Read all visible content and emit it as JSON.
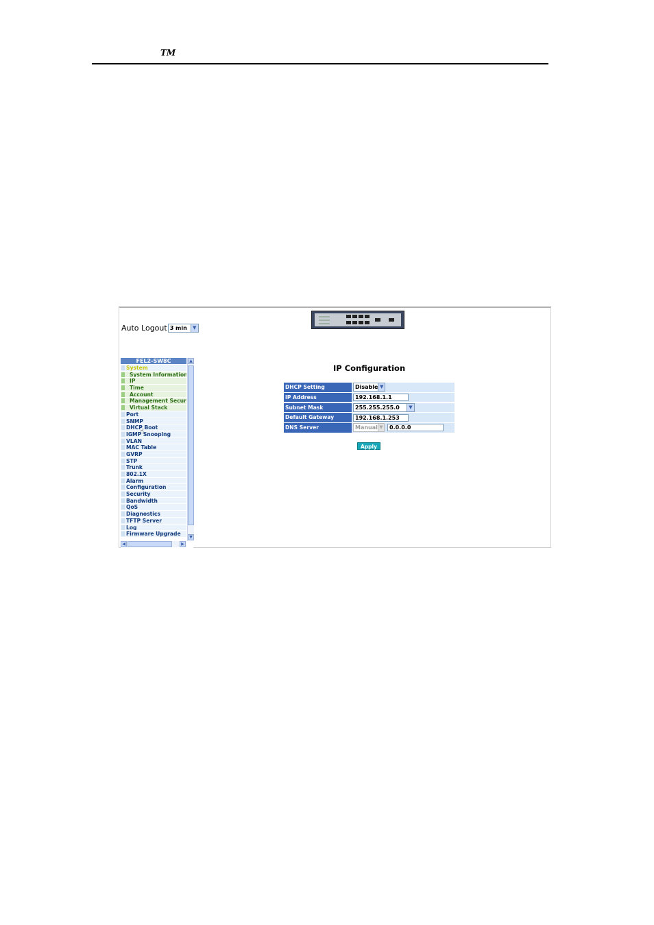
{
  "doc_header": {
    "mark": "TM"
  },
  "auto_logout": {
    "label": "Auto Logout",
    "value": "3 min"
  },
  "menu": {
    "title": "FEL2-SW8C",
    "items": [
      {
        "label": "System",
        "level": 0
      },
      {
        "label": "System Information",
        "level": 1
      },
      {
        "label": "IP",
        "level": 1
      },
      {
        "label": "Time",
        "level": 1
      },
      {
        "label": "Account",
        "level": 1
      },
      {
        "label": "Management Security",
        "level": 1
      },
      {
        "label": "Virtual Stack",
        "level": 1
      },
      {
        "label": "Port",
        "level": 0
      },
      {
        "label": "SNMP",
        "level": 0
      },
      {
        "label": "DHCP Boot",
        "level": 0
      },
      {
        "label": "IGMP Snooping",
        "level": 0
      },
      {
        "label": "VLAN",
        "level": 0
      },
      {
        "label": "MAC Table",
        "level": 0
      },
      {
        "label": "GVRP",
        "level": 0
      },
      {
        "label": "STP",
        "level": 0
      },
      {
        "label": "Trunk",
        "level": 0
      },
      {
        "label": "802.1X",
        "level": 0
      },
      {
        "label": "Alarm",
        "level": 0
      },
      {
        "label": "Configuration",
        "level": 0
      },
      {
        "label": "Security",
        "level": 0
      },
      {
        "label": "Bandwidth",
        "level": 0
      },
      {
        "label": "QoS",
        "level": 0
      },
      {
        "label": "Diagnostics",
        "level": 0
      },
      {
        "label": "TFTP Server",
        "level": 0
      },
      {
        "label": "Log",
        "level": 0
      },
      {
        "label": "Firmware Upgrade",
        "level": 0
      }
    ]
  },
  "ip_config": {
    "title": "IP Configuration",
    "dhcp_label": "DHCP Setting",
    "dhcp_value": "Disable",
    "ip_label": "IP Address",
    "ip_value": "192.168.1.1",
    "mask_label": "Subnet Mask",
    "mask_value": "255.255.255.0",
    "gateway_label": "Default Gateway",
    "gateway_value": "192.168.1.253",
    "dns_label": "DNS Server",
    "dns_mode": "Manual",
    "dns_value": "0.0.0.0",
    "apply_label": "Apply"
  }
}
